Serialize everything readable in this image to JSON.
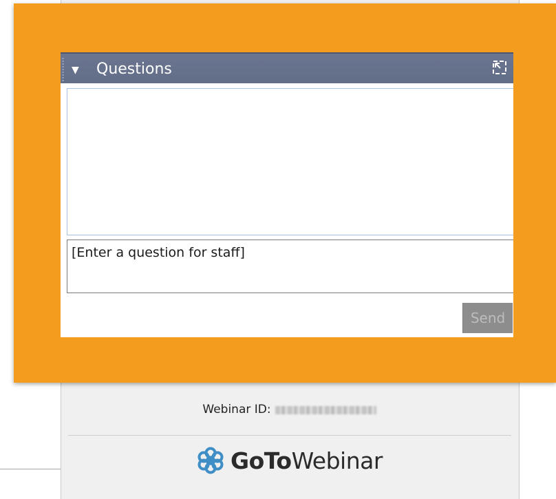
{
  "questions_panel": {
    "title": "Questions",
    "question_placeholder": "[Enter a question for staff]",
    "send_label": "Send"
  },
  "footer": {
    "webinar_id_label": "Webinar ID:",
    "webinar_id_value_redacted": true,
    "brand_bold": "GoTo",
    "brand_light": "Webinar"
  },
  "colors": {
    "highlight": "#f49c1d",
    "header": "#66708b",
    "send_disabled": "#8d8d8d"
  },
  "icons": {
    "collapse": "triangle-down-icon",
    "popout": "popout-icon",
    "logo": "gotowebinar-logo"
  }
}
